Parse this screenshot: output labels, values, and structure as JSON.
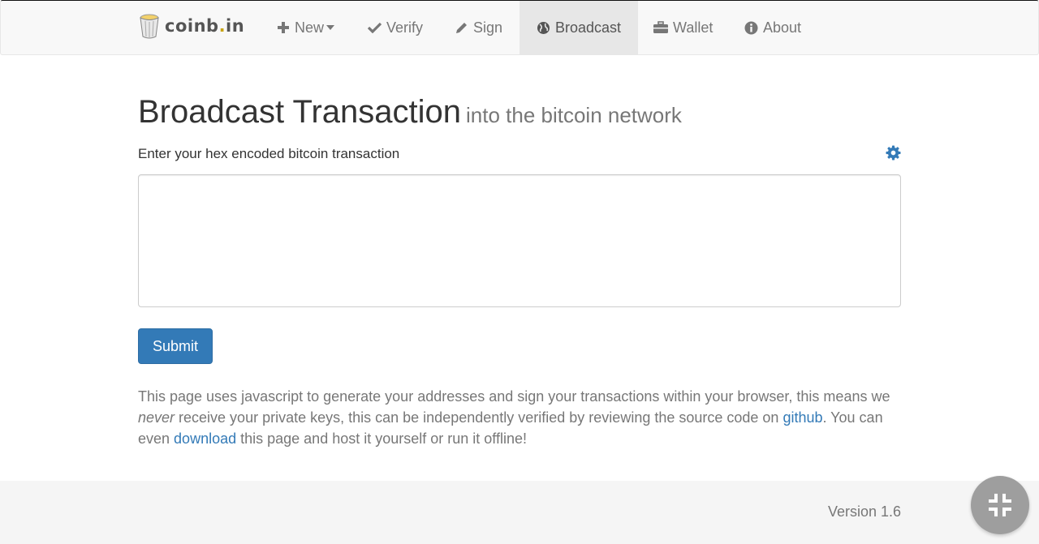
{
  "brand": {
    "name_left": "coinb",
    "name_dot": ".",
    "name_right": "in",
    "icon": "bucket-logo-icon"
  },
  "nav": {
    "items": [
      {
        "label": "New",
        "icon": "plus-icon",
        "dropdown": true
      },
      {
        "label": "Verify",
        "icon": "check-icon"
      },
      {
        "label": "Sign",
        "icon": "pencil-icon"
      },
      {
        "label": "Broadcast",
        "icon": "globe-icon",
        "active": true
      },
      {
        "label": "Wallet",
        "icon": "briefcase-icon"
      },
      {
        "label": "About",
        "icon": "info-circle-icon"
      }
    ]
  },
  "page": {
    "title": "Broadcast Transaction",
    "subtitle": "into the bitcoin network",
    "input_label": "Enter your hex encoded bitcoin transaction",
    "settings_icon": "gear-icon",
    "hex_value": "",
    "submit_label": "Submit"
  },
  "info": {
    "part1": "This page uses javascript to generate your addresses and sign your transactions within your browser, this means we ",
    "never": "never",
    "part2": " receive your private keys, this can be independently verified by reviewing the source code on ",
    "github_link": "github",
    "part3": ". You can even ",
    "download_link": "download",
    "part4": " this page and host it yourself or run it offline!"
  },
  "footer": {
    "version": "Version 1.6"
  },
  "colors": {
    "primary": "#337ab7",
    "nav_bg": "#f8f8f8",
    "active_bg": "#e7e7e7",
    "footer_bg": "#f5f5f5",
    "fab_bg": "#9e9e9e"
  },
  "fab": {
    "icon": "exit-fullscreen-icon"
  }
}
